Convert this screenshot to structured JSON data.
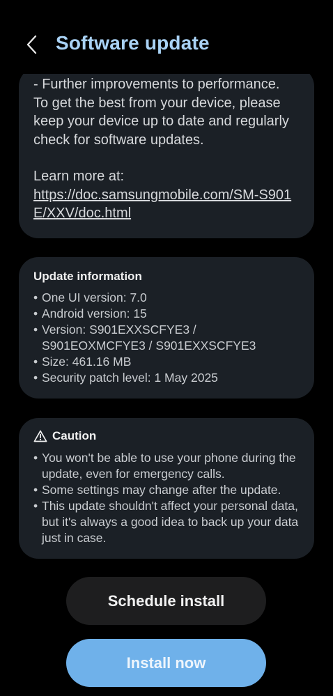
{
  "header": {
    "back_icon": "chevron-left-icon",
    "title": "Software update"
  },
  "release_notes": {
    "text": " - Further improvements to performance.\nTo get the best from your device, please\nkeep your device up to date and regularly\ncheck for software updates.",
    "learn_more_label": "Learn more at:",
    "link_text": "https://doc.samsungmobile.com/SM-S901E/XXV/doc.html"
  },
  "update_info": {
    "heading": "Update information",
    "items": [
      "One UI version: 7.0",
      "Android version: 15",
      "Version: S901EXXSCFYE3 / S901EOXMCFYE3 / S901EXXSCFYE3",
      "Size: 461.16 MB",
      "Security patch level: 1 May 2025"
    ]
  },
  "caution": {
    "icon": "warning-triangle-icon",
    "heading": "Caution",
    "items": [
      "You won't be able to use your phone during the update, even for emergency calls.",
      "Some settings may change after the update.",
      "This update shouldn't affect your personal data, but it's always a good idea to back up your data just in case."
    ]
  },
  "buttons": {
    "schedule_label": "Schedule install",
    "install_label": "Install now"
  },
  "colors": {
    "background": "#000000",
    "card": "#1b2026",
    "title": "#a9d2f5",
    "install_button": "#6fb1ea",
    "schedule_button": "#1e1e1f"
  }
}
